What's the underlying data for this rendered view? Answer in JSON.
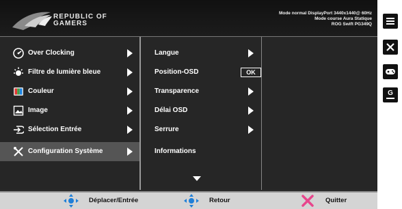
{
  "brand": {
    "line1": "REPUBLIC OF",
    "line2": "GAMERS"
  },
  "status": {
    "line1": "Mode normal DisplayPort 3440x1440@ 60Hz",
    "line2": "Mode course Aura Statique",
    "line3": "ROG Swift PG349Q"
  },
  "menu1": {
    "items": [
      {
        "label": "Over Clocking",
        "icon": "gauge-icon"
      },
      {
        "label": "Filtre de lumière bleue",
        "icon": "sun-icon"
      },
      {
        "label": "Couleur",
        "icon": "color-icon"
      },
      {
        "label": "Image",
        "icon": "image-icon"
      },
      {
        "label": "Sélection Entrée",
        "icon": "input-icon"
      },
      {
        "label": "Configuration Système",
        "icon": "tools-icon"
      }
    ]
  },
  "menu2": {
    "items": [
      {
        "label": "Langue"
      },
      {
        "label": "Position-OSD",
        "badge": "OK"
      },
      {
        "label": "Transparence"
      },
      {
        "label": "Délai OSD"
      },
      {
        "label": "Serrure"
      },
      {
        "label": "Informations"
      }
    ]
  },
  "footer": {
    "move": "Déplacer/Entrée",
    "back": "Retour",
    "exit": "Quitter"
  },
  "side": {
    "button4": "G"
  },
  "colors": {
    "accent_blue": "#1e7fd8",
    "exit_pink": "#e8468c",
    "panel": "#262626",
    "active": "#555555"
  }
}
